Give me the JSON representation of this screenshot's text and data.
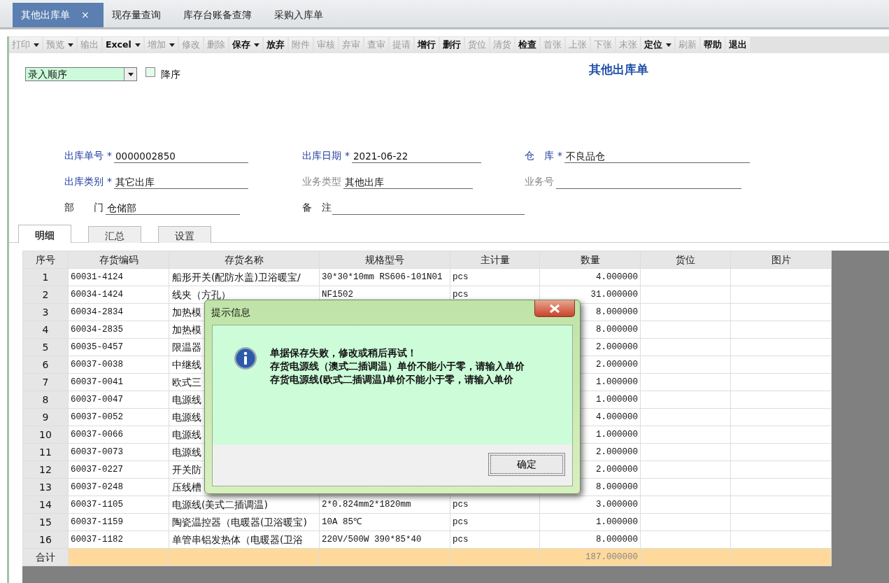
{
  "tabs": [
    {
      "label": "其他出库单",
      "selected": true,
      "closable": true,
      "close": "×"
    },
    {
      "label": "现存量查询",
      "selected": false,
      "closable": false
    },
    {
      "label": "库存台账备查簿",
      "selected": false,
      "closable": false
    },
    {
      "label": "采购入库单",
      "selected": false,
      "closable": false
    }
  ],
  "toolbar": [
    {
      "label": "打印",
      "enabled": false,
      "dropdown": true
    },
    {
      "label": "预览",
      "enabled": false,
      "dropdown": true
    },
    {
      "label": "输出",
      "enabled": false,
      "dropdown": false
    },
    {
      "label": "Excel",
      "enabled": true,
      "dropdown": true
    },
    {
      "label": "增加",
      "enabled": false,
      "dropdown": true
    },
    {
      "label": "修改",
      "enabled": false,
      "dropdown": false
    },
    {
      "label": "删除",
      "enabled": false,
      "dropdown": false
    },
    {
      "label": "保存",
      "enabled": true,
      "dropdown": true
    },
    {
      "label": "放弃",
      "enabled": true,
      "dropdown": false
    },
    {
      "label": "附件",
      "enabled": false,
      "dropdown": false
    },
    {
      "label": "审核",
      "enabled": false,
      "dropdown": false
    },
    {
      "label": "弃审",
      "enabled": false,
      "dropdown": false
    },
    {
      "label": "查审",
      "enabled": false,
      "dropdown": false
    },
    {
      "label": "提请",
      "enabled": false,
      "dropdown": false
    },
    {
      "label": "增行",
      "enabled": true,
      "dropdown": false
    },
    {
      "label": "删行",
      "enabled": true,
      "dropdown": false
    },
    {
      "label": "货位",
      "enabled": false,
      "dropdown": false
    },
    {
      "label": "清货",
      "enabled": false,
      "dropdown": false
    },
    {
      "label": "检查",
      "enabled": true,
      "dropdown": false
    },
    {
      "label": "首张",
      "enabled": false,
      "dropdown": false
    },
    {
      "label": "上张",
      "enabled": false,
      "dropdown": false
    },
    {
      "label": "下张",
      "enabled": false,
      "dropdown": false
    },
    {
      "label": "末张",
      "enabled": false,
      "dropdown": false
    },
    {
      "label": "定位",
      "enabled": true,
      "dropdown": true
    },
    {
      "label": "刷新",
      "enabled": false,
      "dropdown": false
    },
    {
      "label": "帮助",
      "enabled": true,
      "dropdown": false
    },
    {
      "label": "退出",
      "enabled": true,
      "dropdown": false
    }
  ],
  "sort": {
    "value": "录入顺序",
    "descending": {
      "label": "降序",
      "checked": false
    }
  },
  "title": "其他出库单",
  "form_rows": [
    [
      {
        "label": "出库单号",
        "mark": "*",
        "disabled": false,
        "value": "0000002850"
      },
      {
        "label": "出库日期",
        "mark": "*",
        "disabled": false,
        "value": "2021-06-22"
      },
      {
        "label": "仓　库",
        "mark": "*",
        "disabled": false,
        "value": "不良品仓"
      }
    ],
    [
      {
        "label": "出库类别",
        "mark": "*",
        "disabled": false,
        "value": "其它出库"
      },
      {
        "label": "业务类型",
        "disabled": true,
        "value": "其他出库"
      },
      {
        "label": "业务号",
        "disabled": true
      }
    ],
    [
      {
        "label": "部　　门",
        "disabled": false,
        "value": "仓储部"
      },
      {
        "label": "备　注",
        "disabled": false
      }
    ]
  ],
  "subtabs": [
    {
      "label": "明细",
      "selected": true
    },
    {
      "label": "汇总",
      "selected": false
    },
    {
      "label": "设置",
      "selected": false
    }
  ],
  "table": {
    "columns": [
      "序号",
      "存货编码",
      "存货名称",
      "规格型号",
      "主计量",
      "数量",
      "货位",
      "图片"
    ],
    "rows": [
      {
        "no": "1",
        "code": "60031-4124",
        "name": "船形开关(配防水盖)卫浴暖宝/",
        "spec": "30*30*10mm RS606-101N01",
        "unit": "pcs",
        "qty": "4.000000"
      },
      {
        "no": "2",
        "code": "60034-1424",
        "name": "线夹（方孔）",
        "spec": "NF1502",
        "unit": "pcs",
        "qty": "31.000000"
      },
      {
        "no": "3",
        "code": "60034-2834",
        "name": "加热模",
        "qty": "8.000000"
      },
      {
        "no": "4",
        "code": "60034-2835",
        "name": "加热模",
        "qty": "8.000000"
      },
      {
        "no": "5",
        "code": "60035-0457",
        "name": "限温器",
        "qty": "2.000000"
      },
      {
        "no": "6",
        "code": "60037-0038",
        "name": "中继线",
        "qty": "2.000000"
      },
      {
        "no": "7",
        "code": "60037-0041",
        "name": "欧式三",
        "qty": "1.000000"
      },
      {
        "no": "8",
        "code": "60037-0047",
        "name": "电源线",
        "qty": "1.000000"
      },
      {
        "no": "9",
        "code": "60037-0052",
        "name": "电源线",
        "qty": "4.000000"
      },
      {
        "no": "10",
        "code": "60037-0066",
        "name": "电源线",
        "qty": "1.000000"
      },
      {
        "no": "11",
        "code": "60037-0073",
        "name": "电源线",
        "qty": "2.000000"
      },
      {
        "no": "12",
        "code": "60037-0227",
        "name": "开关防",
        "qty": "2.000000"
      },
      {
        "no": "13",
        "code": "60037-0248",
        "name": "压线槽",
        "qty": "8.000000"
      },
      {
        "no": "14",
        "code": "60037-1105",
        "name": "电源线(美式二插调温)",
        "spec": "2*0.824mm2*1820mm",
        "unit": "pcs",
        "qty": "3.000000"
      },
      {
        "no": "15",
        "code": "60037-1159",
        "name": "陶瓷温控器（电暖器(卫浴暖宝)",
        "spec": "10A 85℃",
        "unit": "pcs",
        "qty": "1.000000"
      },
      {
        "no": "16",
        "code": "60037-1182",
        "name": "单管串铝发热体（电暖器(卫浴",
        "spec": "220V/500W 390*85*40",
        "unit": "pcs",
        "qty": "8.000000"
      }
    ],
    "total": {
      "label": "合计",
      "qty": "187.000000"
    }
  },
  "dialog": {
    "title": "提示信息",
    "lines": [
      "单据保存失败，修改或稍后再试！",
      "存货电源线（澳式二插调温）单价不能小于零，请输入单价",
      "存货电源线(欧式二插调温)单价不能小于零，请输入单价"
    ],
    "button": "确定"
  }
}
